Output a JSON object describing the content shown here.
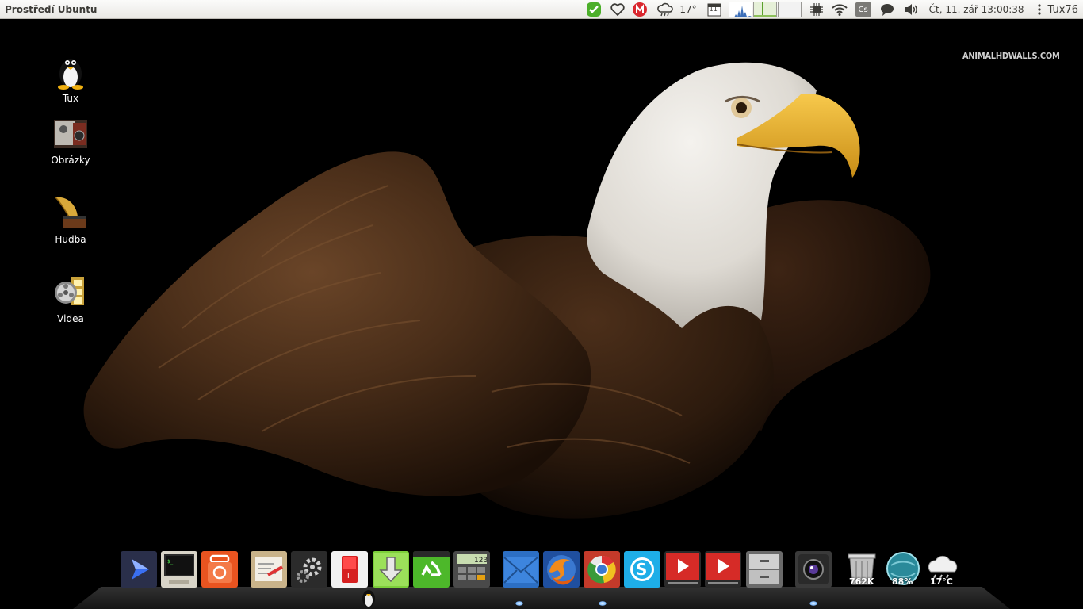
{
  "panel": {
    "window_title": "Prostředí Ubuntu",
    "weather_temp": "17°",
    "calendar_day": "11",
    "keyboard_layout": "Cs",
    "clock": "Čt, 11. zář 13:00:38",
    "user": "Tux76"
  },
  "wallpaper": {
    "watermark": "ANIMALHDWALLS.COM"
  },
  "desktop": {
    "icons": [
      {
        "label": "Tux",
        "icon": "tux-penguin-icon"
      },
      {
        "label": "Obrázky",
        "icon": "pictures-folder-icon"
      },
      {
        "label": "Hudba",
        "icon": "music-gramophone-icon"
      },
      {
        "label": "Videa",
        "icon": "videos-film-icon"
      }
    ]
  },
  "dock": {
    "items": [
      {
        "name": "media-player",
        "icon": "play-arrow-icon"
      },
      {
        "name": "terminal",
        "icon": "terminal-icon"
      },
      {
        "name": "ubuntu-software",
        "icon": "ubuntu-bag-icon"
      },
      {
        "name": "archive-manager",
        "icon": "archive-box-icon"
      },
      {
        "name": "system-settings",
        "icon": "gears-icon"
      },
      {
        "name": "shutdown",
        "icon": "power-switch-icon"
      },
      {
        "name": "downloads",
        "icon": "download-arrow-icon"
      },
      {
        "name": "trash-recycle",
        "icon": "recycle-icon"
      },
      {
        "name": "calculator",
        "icon": "calculator-icon"
      },
      {
        "name": "mail",
        "icon": "envelope-icon"
      },
      {
        "name": "firefox",
        "icon": "firefox-icon"
      },
      {
        "name": "chromium",
        "icon": "chrome-icon"
      },
      {
        "name": "skype",
        "icon": "skype-icon"
      },
      {
        "name": "youtube-1",
        "icon": "youtube-play-icon"
      },
      {
        "name": "youtube-2",
        "icon": "youtube-play-icon"
      },
      {
        "name": "file-cabinet",
        "icon": "file-cabinet-icon"
      },
      {
        "name": "camera",
        "icon": "webcam-icon"
      }
    ],
    "calculator_display": "123",
    "widgets": {
      "trash_size": "762K",
      "cpu_percent": "88%",
      "weather_temp": "17°C"
    }
  },
  "colors": {
    "panel_bg": "#efeeec",
    "panel_text": "#3c3b37",
    "youtube_red": "#d62b27",
    "skype_blue": "#1eaee8",
    "ubuntu_orange": "#e95420"
  }
}
